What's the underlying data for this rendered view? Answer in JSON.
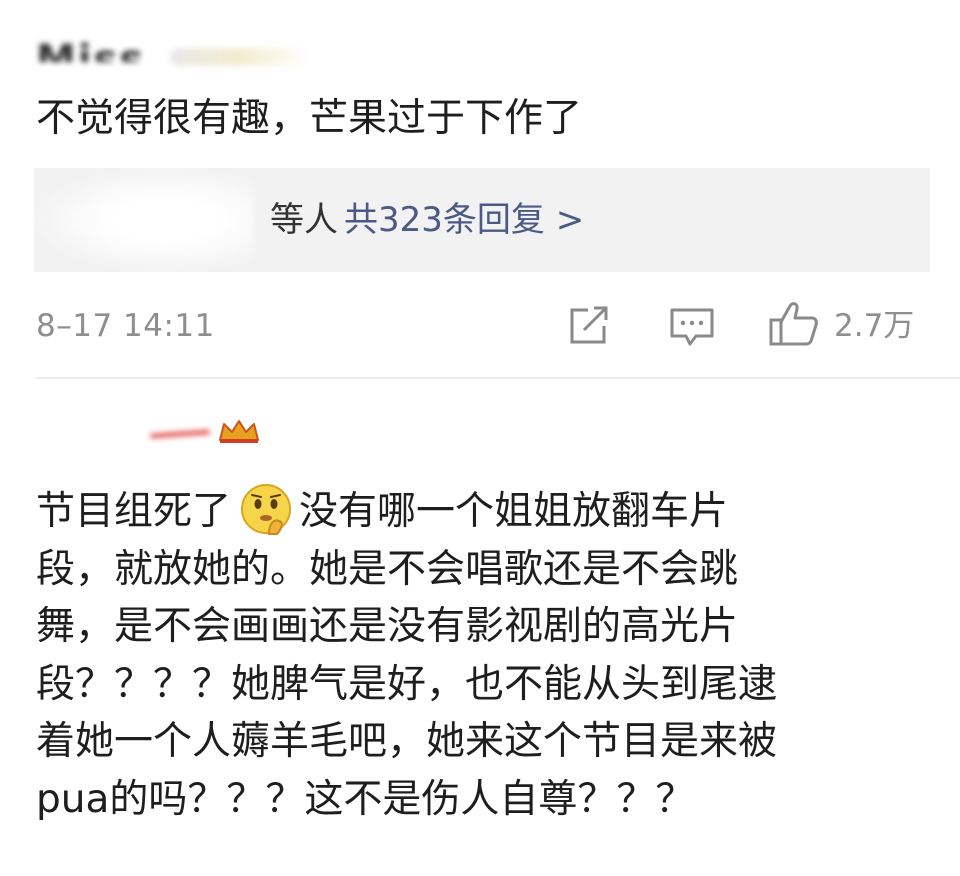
{
  "comments": [
    {
      "username": "Miss",
      "text": "不觉得很有趣，芒果过于下作了",
      "replies": {
        "who": "等人",
        "count_label": "共323条回复 >"
      },
      "timestamp": "8–17 14:11",
      "like_count": "2.7万"
    },
    {
      "lines": [
        "节目组死了",
        "没有哪一个姐姐放翻车片",
        "段，就放她的。她是不会唱歌还是不会跳",
        "舞，是不会画画还是没有影视剧的高光片",
        "段？？？？她脾气是好，也不能从头到尾逮",
        "着她一个人薅羊毛吧，她来这个节目是来被",
        "pua的吗？？？这不是伤人自尊？？？"
      ],
      "emoji": "thinking-face"
    }
  ],
  "icons": {
    "share": "share-icon",
    "comment": "comment-icon",
    "like": "thumbs-up-icon"
  },
  "colors": {
    "link": "#4a5a85",
    "meta": "#8e8e8e",
    "reply_bg": "#f2f2f2"
  }
}
